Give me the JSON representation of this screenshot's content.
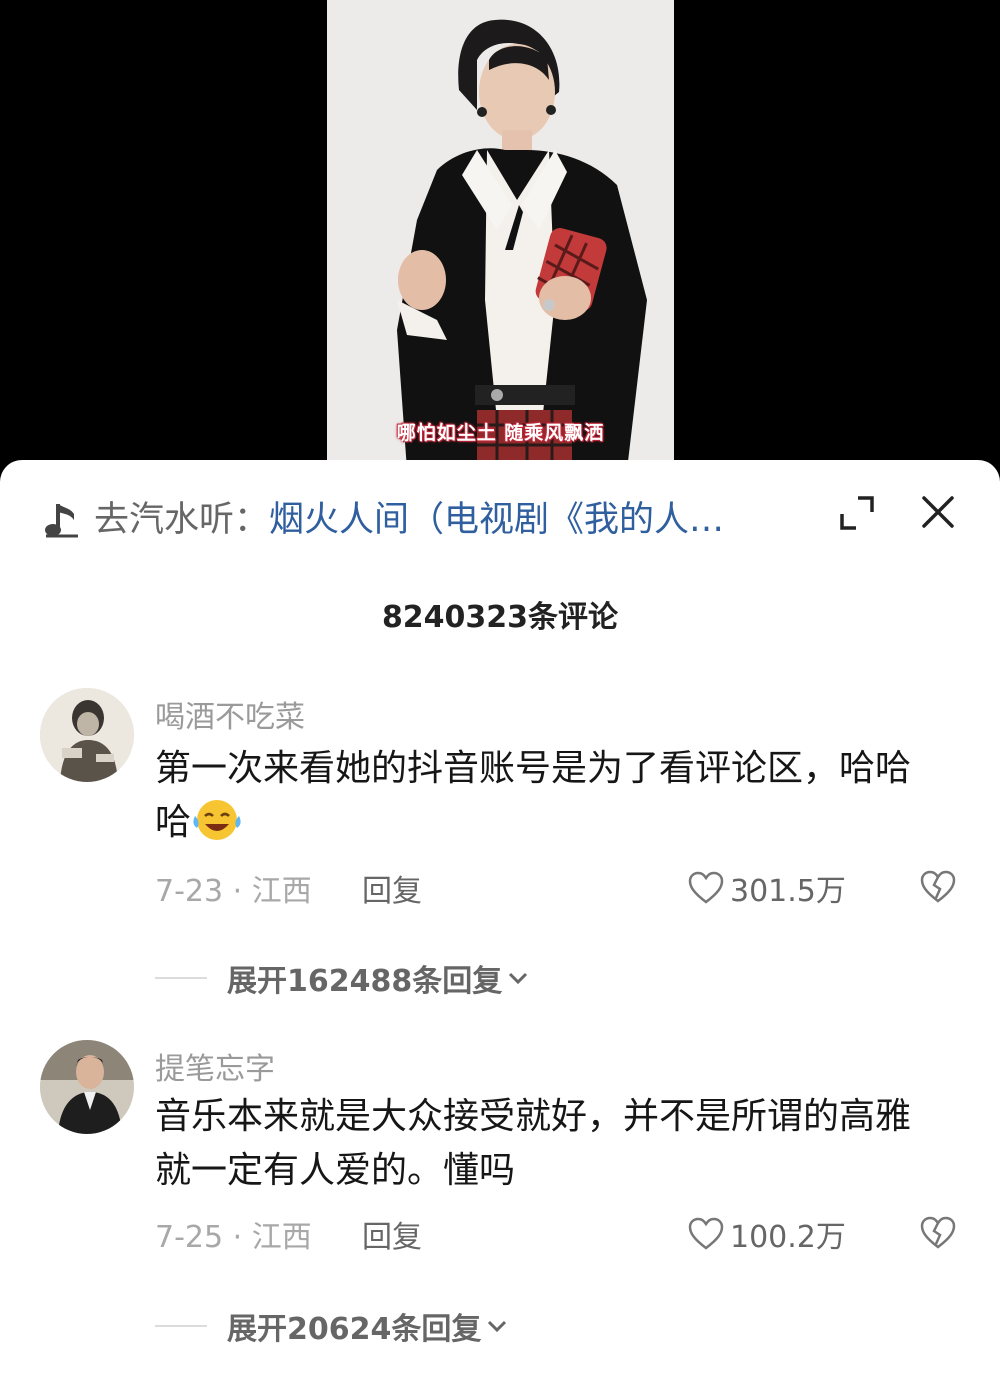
{
  "video": {
    "caption": "哪怕如尘土 随乘风飘洒"
  },
  "music_bar": {
    "icon": "music-note-icon",
    "prefix": "去汽水听：",
    "title": "烟火人间（电视剧《我的人…",
    "expand_icon": "expand-icon",
    "close_icon": "close-icon"
  },
  "comment_count": "8240323条评论",
  "comments": [
    {
      "username": "喝酒不吃菜",
      "text": "第一次来看她的抖音账号是为了看评论区，哈哈哈",
      "emoji": "laughing-tears-emoji",
      "date_location": "7-23 · 江西",
      "reply_label": "回复",
      "likes": "301.5万",
      "expand_replies": "展开162488条回复"
    },
    {
      "username": "提笔忘字",
      "text": "音乐本来就是大众接受就好，并不是所谓的高雅就一定有人爱的。懂吗",
      "date_location": "7-25 · 江西",
      "reply_label": "回复",
      "likes": "100.2万",
      "expand_replies": "展开20624条回复"
    }
  ],
  "colors": {
    "link_blue": "#2f5f9e",
    "caption_outline": "#c0283a",
    "sheet_bg": "#ffffff"
  }
}
